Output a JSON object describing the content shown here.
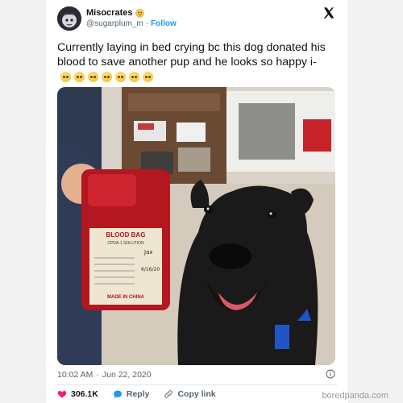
{
  "tweet": {
    "display_name": "Misocrates",
    "handle": "@sugarplum_m",
    "separator": "·",
    "follow_label": "Follow",
    "text": "Currently laying in bed crying bc this dog donated his blood to save another pup and he looks so happy i-",
    "emoji_count": 7,
    "emoji_name": "pleading-face-emoji",
    "time": "10:02 AM",
    "date": "Jun 22, 2020"
  },
  "photo": {
    "bag_title": "BLOOD BAG",
    "bag_subtitle": "CPDA-1 SOLUTION",
    "bag_name_label": "Jax",
    "bag_date_label": "6/16/20",
    "bag_origin": "MADE IN CHINA"
  },
  "actions": {
    "likes": "306.1K",
    "reply_label": "Reply",
    "copy_link_label": "Copy link"
  },
  "watermark": "boredpanda.com",
  "colors": {
    "link_blue": "#1d9bf0",
    "like_red": "#f91880",
    "text_dark": "#0f1419",
    "text_muted": "#536471"
  }
}
